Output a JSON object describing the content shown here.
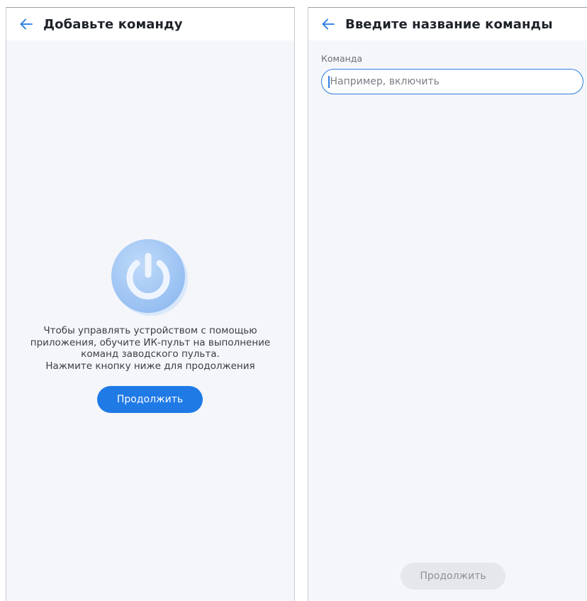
{
  "left_screen": {
    "back_icon": "arrow-left-icon",
    "title": "Добавьте команду",
    "illustration_icon": "power-icon",
    "description_lines": [
      "Чтобы управлять устройством с помощью",
      "приложения, обучите ИК-пульт на выполнение",
      "команд заводского пульта.",
      "Нажмите кнопку ниже для продолжения"
    ],
    "continue_label": "Продолжить"
  },
  "right_screen": {
    "back_icon": "arrow-left-icon",
    "title": "Введите название команды",
    "field_label": "Команда",
    "field_placeholder": "Например, включить",
    "field_value": "",
    "continue_label": "Продолжить",
    "continue_enabled": false
  },
  "colors": {
    "accent": "#1f7ae6",
    "background": "#f4f6fa",
    "disabled_button": "#e5e7eb"
  }
}
